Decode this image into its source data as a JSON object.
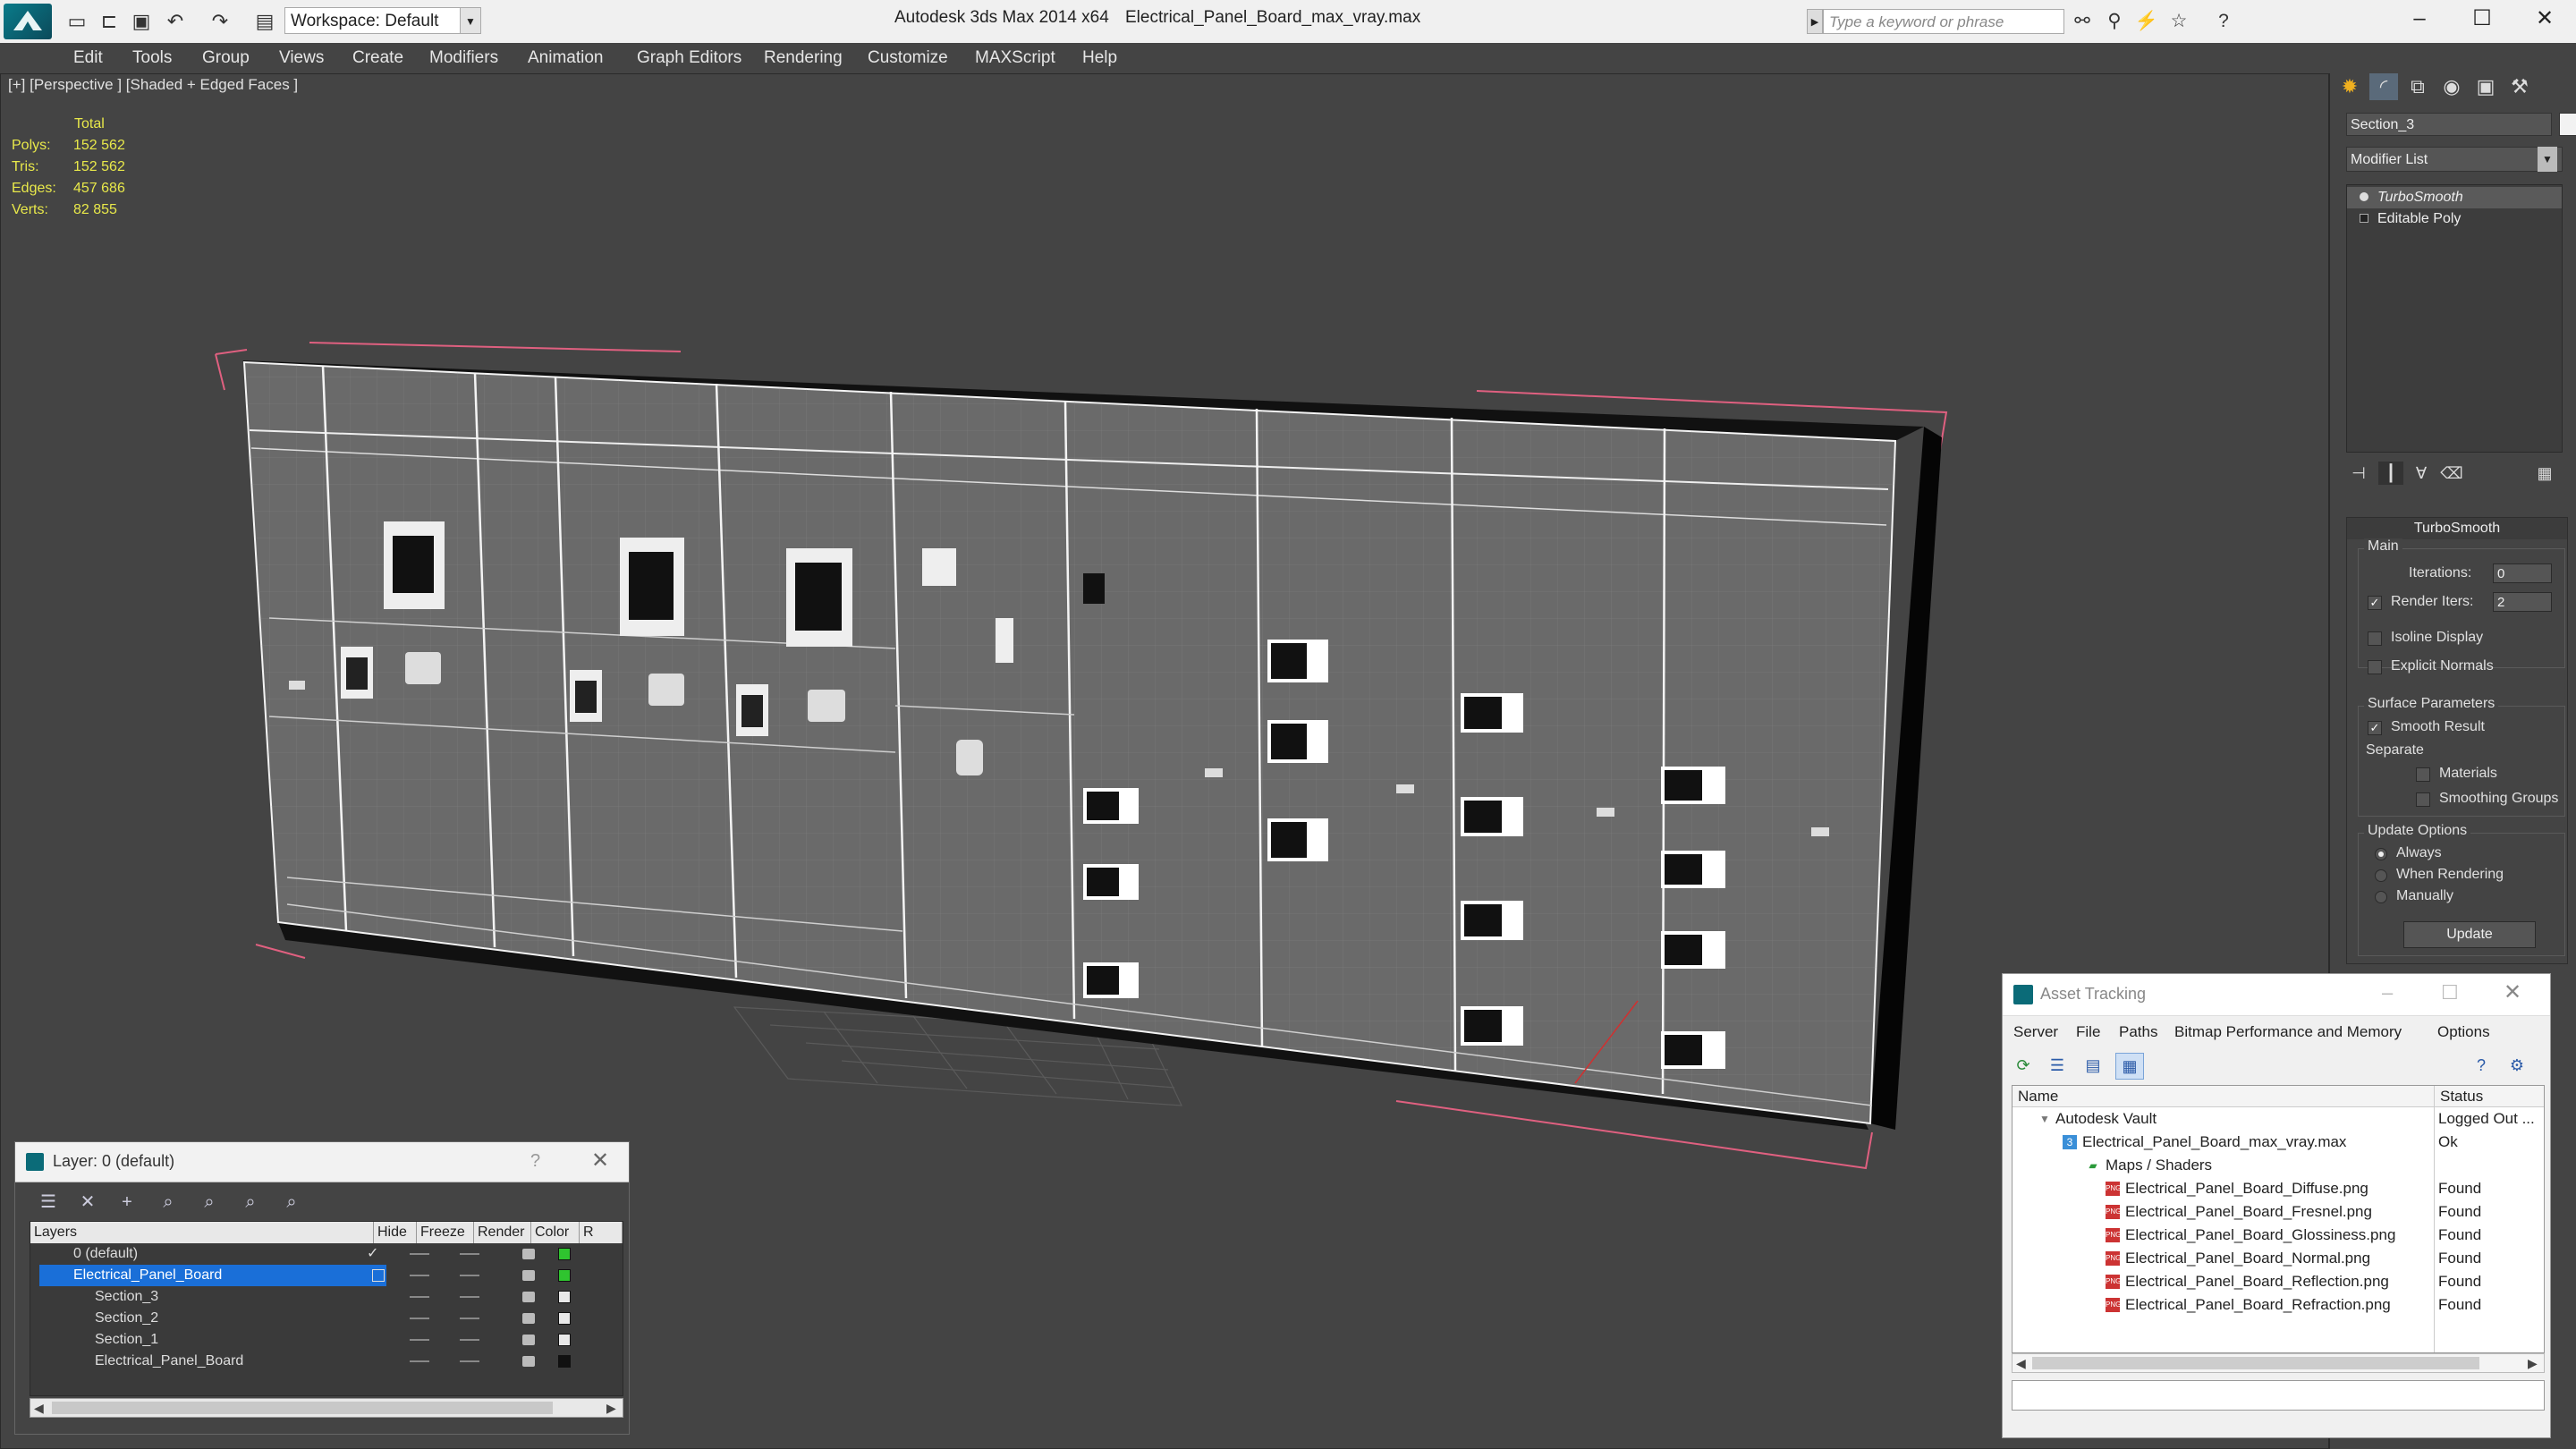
{
  "titlebar": {
    "workspace": "Workspace: Default",
    "app_title": "Autodesk 3ds Max  2014 x64",
    "file_name": "Electrical_Panel_Board_max_vray.max",
    "search_placeholder": "Type a keyword or phrase"
  },
  "menu": [
    "Edit",
    "Tools",
    "Group",
    "Views",
    "Create",
    "Modifiers",
    "Animation",
    "Graph Editors",
    "Rendering",
    "Customize",
    "MAXScript",
    "Help"
  ],
  "viewport": {
    "label": "[+] [Perspective ] [Shaded + Edged Faces ]",
    "stats": {
      "header": "Total",
      "polys_label": "Polys:",
      "polys": "152 562",
      "tris_label": "Tris:",
      "tris": "152 562",
      "edges_label": "Edges:",
      "edges": "457 686",
      "verts_label": "Verts:",
      "verts": "82 855"
    }
  },
  "command_panel": {
    "object_name": "Section_3",
    "modifier_list": "Modifier List",
    "stack": [
      "TurboSmooth",
      "Editable Poly"
    ],
    "rollout_title": "TurboSmooth",
    "main_label": "Main",
    "iterations_label": "Iterations:",
    "iterations": "0",
    "render_iters_label": "Render Iters:",
    "render_iters": "2",
    "isoline": "Isoline Display",
    "explicit_normals": "Explicit Normals",
    "surface_params": "Surface Parameters",
    "smooth_result": "Smooth Result",
    "separate": "Separate",
    "materials": "Materials",
    "smoothing_groups": "Smoothing Groups",
    "update_options": "Update Options",
    "always": "Always",
    "when_rendering": "When Rendering",
    "manually": "Manually",
    "update_button": "Update"
  },
  "layer_window": {
    "title": "Layer: 0 (default)",
    "help": "?",
    "columns": [
      "Layers",
      "Hide",
      "Freeze",
      "Render",
      "Color",
      "R"
    ],
    "rows": [
      {
        "name": "0 (default)",
        "color": "#2fc42f"
      },
      {
        "name": "Electrical_Panel_Board",
        "color": "#2fc42f"
      },
      {
        "name": "Section_3",
        "color": "#e8e8e8"
      },
      {
        "name": "Section_2",
        "color": "#e8e8e8"
      },
      {
        "name": "Section_1",
        "color": "#e8e8e8"
      },
      {
        "name": "Electrical_Panel_Board",
        "color": "#111111"
      }
    ]
  },
  "asset_window": {
    "title": "Asset Tracking",
    "menu": [
      "Server",
      "File",
      "Paths",
      "Bitmap Performance and Memory",
      "Options"
    ],
    "columns": [
      "Name",
      "Status"
    ],
    "rows": [
      {
        "name": "Autodesk Vault",
        "status": "Logged Out ..."
      },
      {
        "name": "Electrical_Panel_Board_max_vray.max",
        "status": "Ok"
      },
      {
        "name": "Maps / Shaders",
        "status": ""
      },
      {
        "name": "Electrical_Panel_Board_Diffuse.png",
        "status": "Found"
      },
      {
        "name": "Electrical_Panel_Board_Fresnel.png",
        "status": "Found"
      },
      {
        "name": "Electrical_Panel_Board_Glossiness.png",
        "status": "Found"
      },
      {
        "name": "Electrical_Panel_Board_Normal.png",
        "status": "Found"
      },
      {
        "name": "Electrical_Panel_Board_Reflection.png",
        "status": "Found"
      },
      {
        "name": "Electrical_Panel_Board_Refraction.png",
        "status": "Found"
      }
    ]
  },
  "colors": {
    "selection_blue": "#1a6fd8",
    "stats_yellow": "#e8e84a",
    "bbox_pink": "#e06080"
  }
}
